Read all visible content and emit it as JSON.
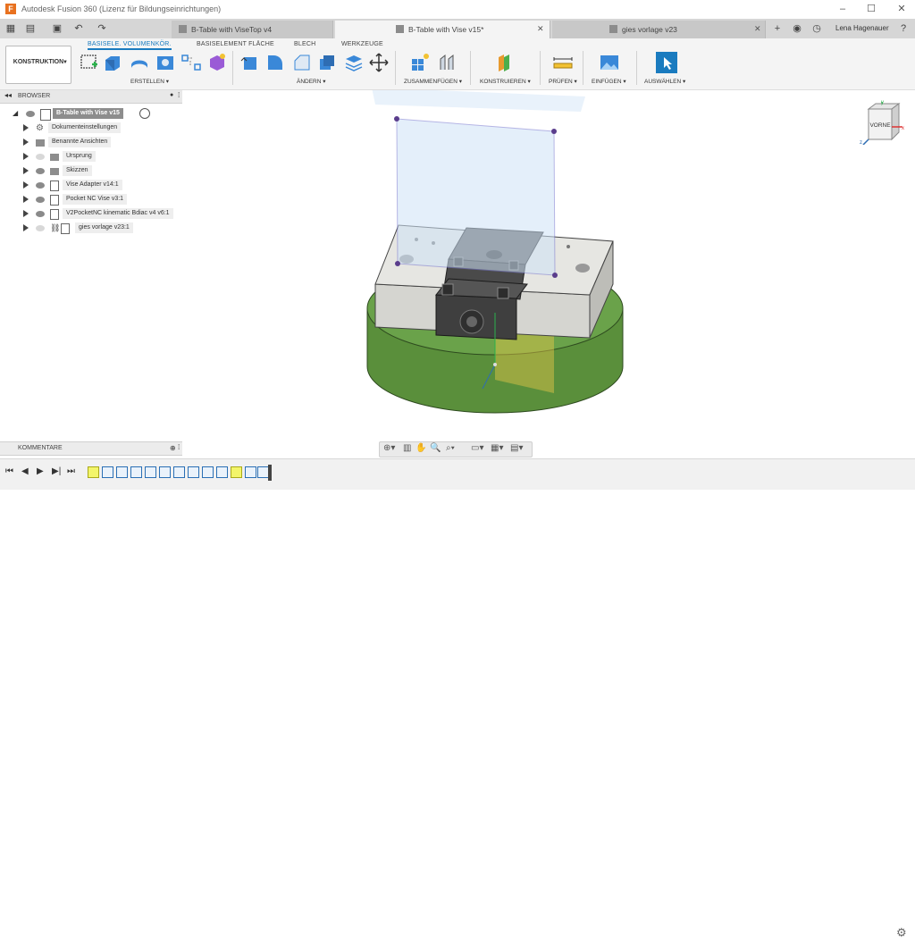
{
  "window": {
    "title": "Autodesk Fusion 360 (Lizenz für Bildungseinrichtungen)",
    "app_icon_letter": "F"
  },
  "tabs": [
    {
      "label": "B-Table with ViseTop v4",
      "active": false
    },
    {
      "label": "B-Table with Vise v15*",
      "active": true
    },
    {
      "label": "gies vorlage v23",
      "active": false
    }
  ],
  "user": {
    "name": "Lena Hagenauer"
  },
  "ribbon": {
    "workspace": "KONSTRUKTION",
    "tabs": [
      "BASISELE. VOLUMENKÖR.",
      "BASISELEMENT FLÄCHE",
      "BLECH",
      "WERKZEUGE"
    ],
    "active_tab": "BASISELE. VOLUMENKÖR.",
    "groups": [
      "ERSTELLEN",
      "ÄNDERN",
      "ZUSAMMENFÜGEN",
      "KONSTRUIEREN",
      "PRÜFEN",
      "EINFÜGEN",
      "AUSWÄHLEN"
    ]
  },
  "browser": {
    "title": "BROWSER",
    "root": "B-Table with Vise v15",
    "items": [
      {
        "label": "Dokumenteinstellungen",
        "icon": "gear-icon",
        "visible": null
      },
      {
        "label": "Benannte Ansichten",
        "icon": "folder-icon",
        "visible": null
      },
      {
        "label": "Ursprung",
        "icon": "folder-icon",
        "visible": false
      },
      {
        "label": "Skizzen",
        "icon": "folder-icon",
        "visible": true
      },
      {
        "label": "Vise Adapter v14:1",
        "icon": "component-icon",
        "visible": true
      },
      {
        "label": "Pocket NC Vise v3:1",
        "icon": "component-icon",
        "visible": true
      },
      {
        "label": "V2PocketNC kinematic Bdiac v4 v6:1",
        "icon": "component-icon",
        "visible": true
      },
      {
        "label": "gies vorlage v23:1",
        "icon": "link-icon",
        "visible": false
      }
    ]
  },
  "comments": {
    "title": "KOMMENTARE"
  },
  "viewcube": {
    "face_label": "VORNE"
  },
  "colors": {
    "accent": "#1a7bbf",
    "cylinder": "#5a8f3b",
    "plane": "#cfe3f7"
  }
}
